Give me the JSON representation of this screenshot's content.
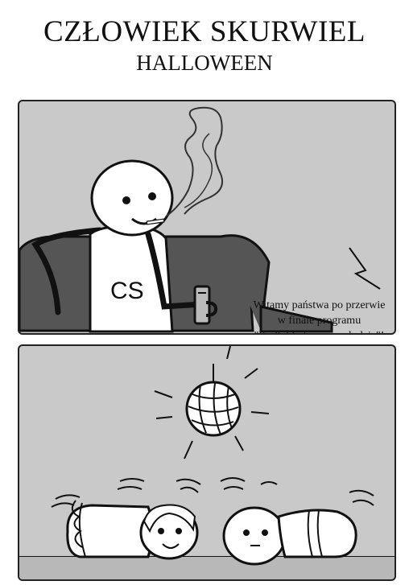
{
  "comic": {
    "title": "CZŁOWIEK SKURWIEL",
    "subtitle": "HALLOWEEN"
  },
  "panel1": {
    "shirt_text": "CS",
    "speech_line1": "Witamy państwa po przerwie",
    "speech_line2": "w finale programu",
    "speech_line3": "\"Kadłubki tańczą na lodzie\"!"
  }
}
